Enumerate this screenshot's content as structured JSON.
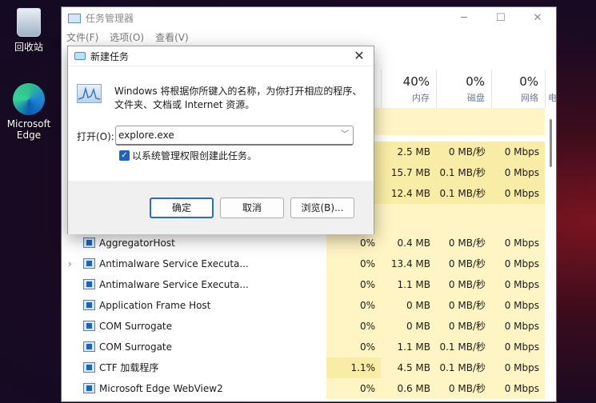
{
  "desktop": {
    "icons": [
      {
        "label": "回收站",
        "icon": "recycle-bin-icon"
      },
      {
        "label": "Microsoft Edge",
        "icon": "edge-icon"
      }
    ]
  },
  "taskmgr": {
    "title": "任务管理器",
    "menu": [
      "文件(F)",
      "选项(O)",
      "查看(V)"
    ],
    "columns": [
      {
        "pct": "40%",
        "label": "内存"
      },
      {
        "pct": "0%",
        "label": "磁盘"
      },
      {
        "pct": "0%",
        "label": "网络"
      },
      {
        "label": "电"
      }
    ],
    "partial_rows": [
      {
        "mem": "2.5 MB",
        "disk": "0 MB/秒",
        "net": "0 Mbps"
      },
      {
        "mem": "15.7 MB",
        "disk": "0.1 MB/秒",
        "net": "0 Mbps"
      },
      {
        "mem": "12.4 MB",
        "disk": "0.1 MB/秒",
        "net": "0 Mbps"
      }
    ],
    "rows": [
      {
        "name": "AggregatorHost",
        "cpu": "0%",
        "mem": "0.4 MB",
        "disk": "0 MB/秒",
        "net": "0 Mbps",
        "expand": false
      },
      {
        "name": "Antimalware Service Executa...",
        "cpu": "0%",
        "mem": "13.4 MB",
        "disk": "0 MB/秒",
        "net": "0 Mbps",
        "expand": true
      },
      {
        "name": "Antimalware Service Executa...",
        "cpu": "0%",
        "mem": "1.1 MB",
        "disk": "0 MB/秒",
        "net": "0 Mbps",
        "expand": false
      },
      {
        "name": "Application Frame Host",
        "cpu": "0%",
        "mem": "0 MB",
        "disk": "0 MB/秒",
        "net": "0 Mbps",
        "expand": false
      },
      {
        "name": "COM Surrogate",
        "cpu": "0%",
        "mem": "0 MB",
        "disk": "0 MB/秒",
        "net": "0 Mbps",
        "expand": false
      },
      {
        "name": "COM Surrogate",
        "cpu": "0%",
        "mem": "1.1 MB",
        "disk": "0.1 MB/秒",
        "net": "0 Mbps",
        "expand": false
      },
      {
        "name": "CTF 加载程序",
        "cpu": "1.1%",
        "mem": "4.5 MB",
        "disk": "0.1 MB/秒",
        "net": "0 Mbps",
        "expand": false
      },
      {
        "name": "Microsoft Edge WebView2",
        "cpu": "0%",
        "mem": "0.6 MB",
        "disk": "0 MB/秒",
        "net": "0 Mbps",
        "expand": false
      }
    ]
  },
  "dialog": {
    "title": "新建任务",
    "description_line1": "Windows 将根据你所键入的名称，为你打开相应的程序、",
    "description_line2": "文件夹、文档或 Internet 资源。",
    "open_label": "打开(O):",
    "open_value": "explore.exe",
    "admin_checkbox_label": "以系统管理权限创建此任务。",
    "admin_checked": true,
    "ok": "确定",
    "cancel": "取消",
    "browse": "浏览(B)..."
  }
}
